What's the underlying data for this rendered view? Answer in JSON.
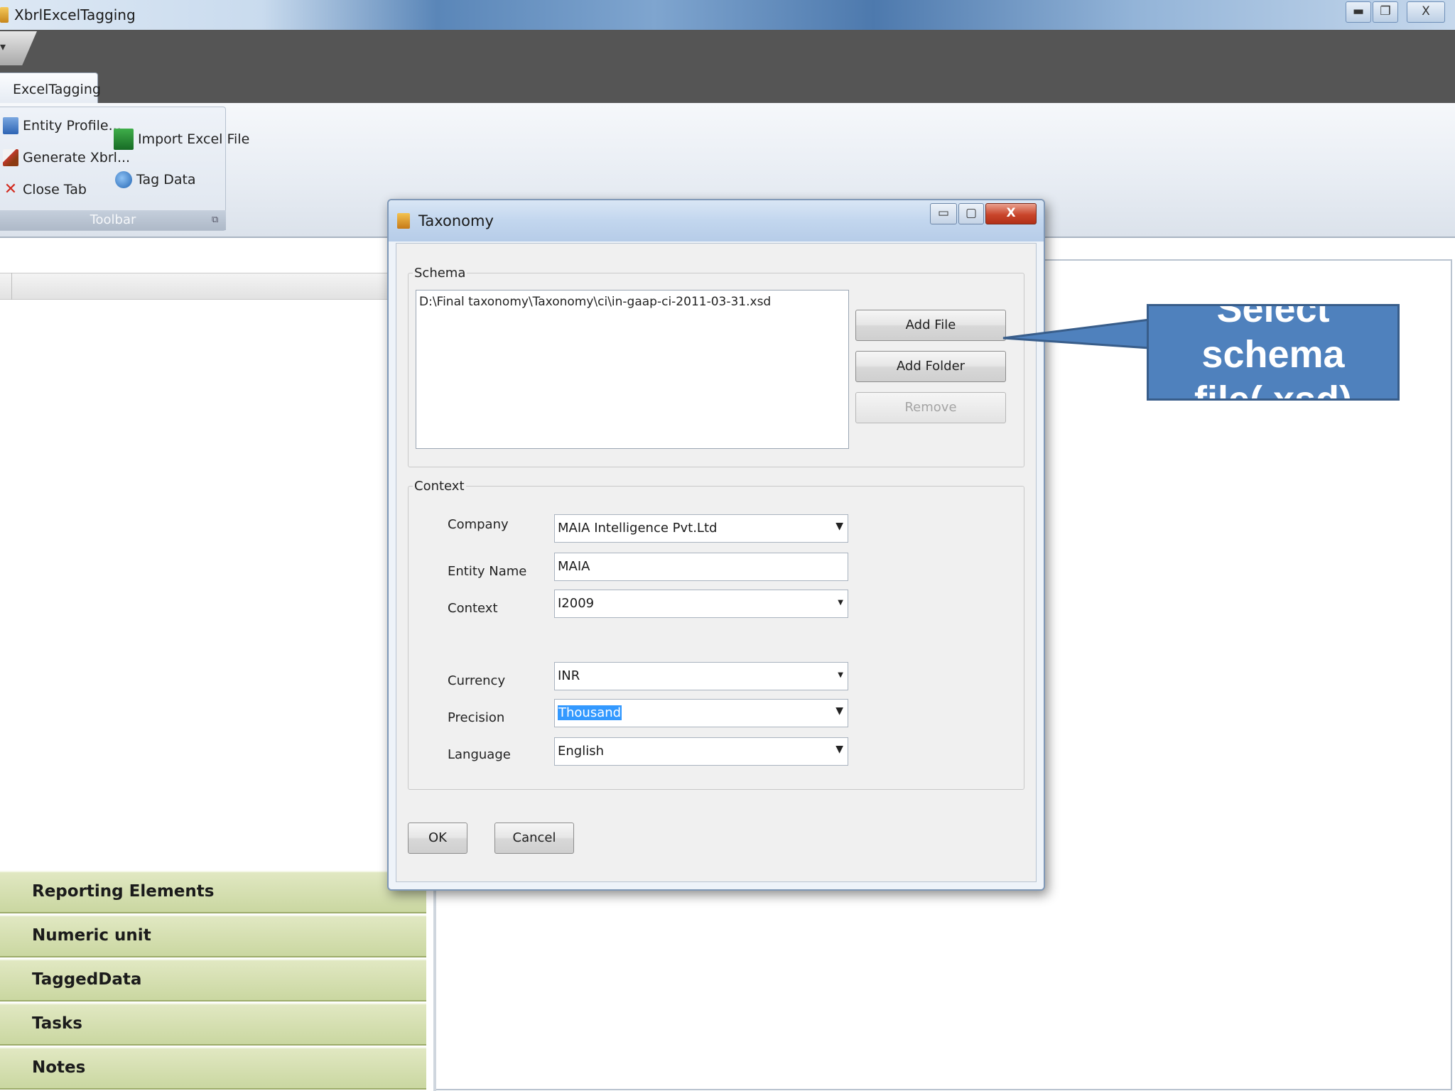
{
  "window": {
    "title": "XbrlExcelTagging"
  },
  "ribbon": {
    "tab": "ExcelTagging",
    "group_label": "Toolbar",
    "items": {
      "entity_profile": "Entity Profile...",
      "generate_xbrl": "Generate Xbrl...",
      "close_tab": "Close Tab",
      "import_excel": "Import Excel File",
      "tag_data": "Tag Data"
    }
  },
  "left_panel": {
    "nav": [
      "Reporting Elements",
      "Numeric unit",
      "TaggedData",
      "Tasks",
      "Notes"
    ]
  },
  "dialog": {
    "title": "Taxonomy",
    "schema": {
      "legend": "Schema",
      "files": [
        "D:\\Final taxonomy\\Taxonomy\\ci\\in-gaap-ci-2011-03-31.xsd"
      ],
      "buttons": {
        "add_file": "Add File",
        "add_folder": "Add Folder",
        "remove": "Remove"
      }
    },
    "context": {
      "legend": "Context",
      "company": {
        "label": "Company",
        "value": "MAIA Intelligence Pvt.Ltd"
      },
      "entity_name": {
        "label": "Entity Name",
        "value": "MAIA"
      },
      "context": {
        "label": "Context",
        "value": "I2009"
      },
      "currency": {
        "label": "Currency",
        "value": "INR"
      },
      "precision": {
        "label": "Precision",
        "value": "Thousand"
      },
      "language": {
        "label": "Language",
        "value": "English"
      }
    },
    "ok": "OK",
    "cancel": "Cancel"
  },
  "callout": {
    "text": "Select schema file(.xsd)"
  },
  "colors": {
    "callout_fill": "#4f81bd",
    "nav_fill": "#cad7a1",
    "selection": "#3399ff",
    "ribbon_dark": "#555555"
  }
}
